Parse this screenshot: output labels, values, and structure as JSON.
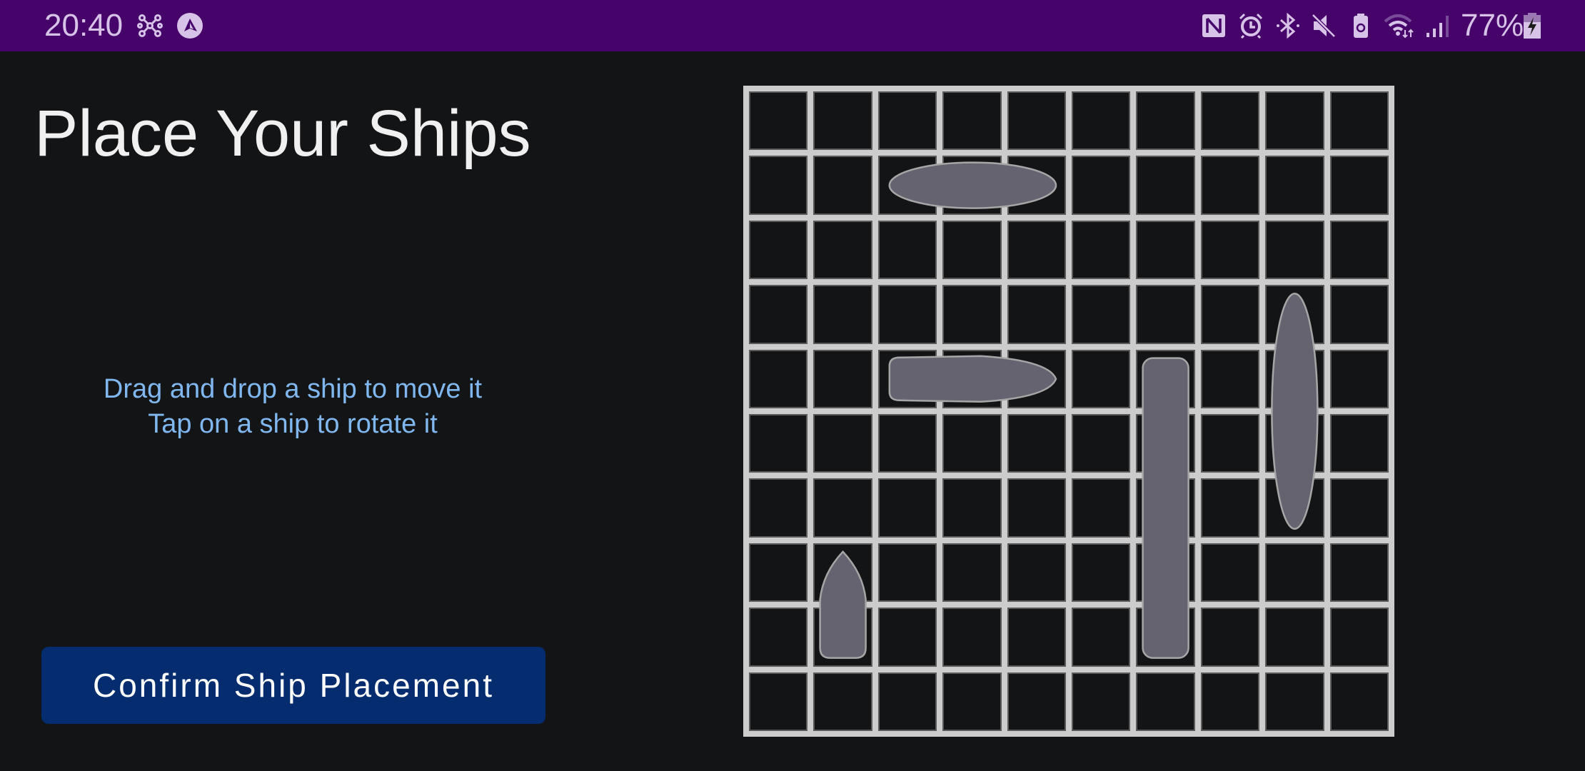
{
  "status_bar": {
    "time": "20:40",
    "left_icons": [
      "network-hub-icon",
      "app-triangle-icon"
    ],
    "right_icons": [
      "nfc-icon",
      "alarm-icon",
      "bluetooth-icon",
      "mute-icon",
      "battery-saver-icon",
      "wifi-icon",
      "cell-signal-icon"
    ],
    "battery_percent": "77%",
    "battery_icon": "battery-charging-icon"
  },
  "screen": {
    "title": "Place Your Ships",
    "instructions": [
      "Drag and drop a ship to move it",
      "Tap on a ship to rotate it"
    ],
    "confirm_button_label": "Confirm Ship Placement"
  },
  "board": {
    "rows": 10,
    "cols": 10,
    "colors": {
      "grid_line": "#cccccc",
      "cell": "#131416",
      "ship_fill": "#64636f",
      "ship_stroke": "#a6a6a6"
    },
    "ships": [
      {
        "id": "ship-ellipse-horizontal",
        "shape": "ellipse",
        "orientation": "horizontal",
        "row": 1,
        "col": 2,
        "length": 3
      },
      {
        "id": "ship-bullet-horizontal",
        "shape": "bullet",
        "orientation": "horizontal",
        "row": 4,
        "col": 2,
        "length": 3
      },
      {
        "id": "ship-rect-vertical",
        "shape": "rounded-rect",
        "orientation": "vertical",
        "row": 4,
        "col": 6,
        "length": 5
      },
      {
        "id": "ship-ellipse-vertical",
        "shape": "ellipse",
        "orientation": "vertical",
        "row": 3,
        "col": 8,
        "length": 4
      },
      {
        "id": "ship-boat-vertical",
        "shape": "bullet",
        "orientation": "vertical",
        "row": 7,
        "col": 1,
        "length": 2
      }
    ]
  }
}
